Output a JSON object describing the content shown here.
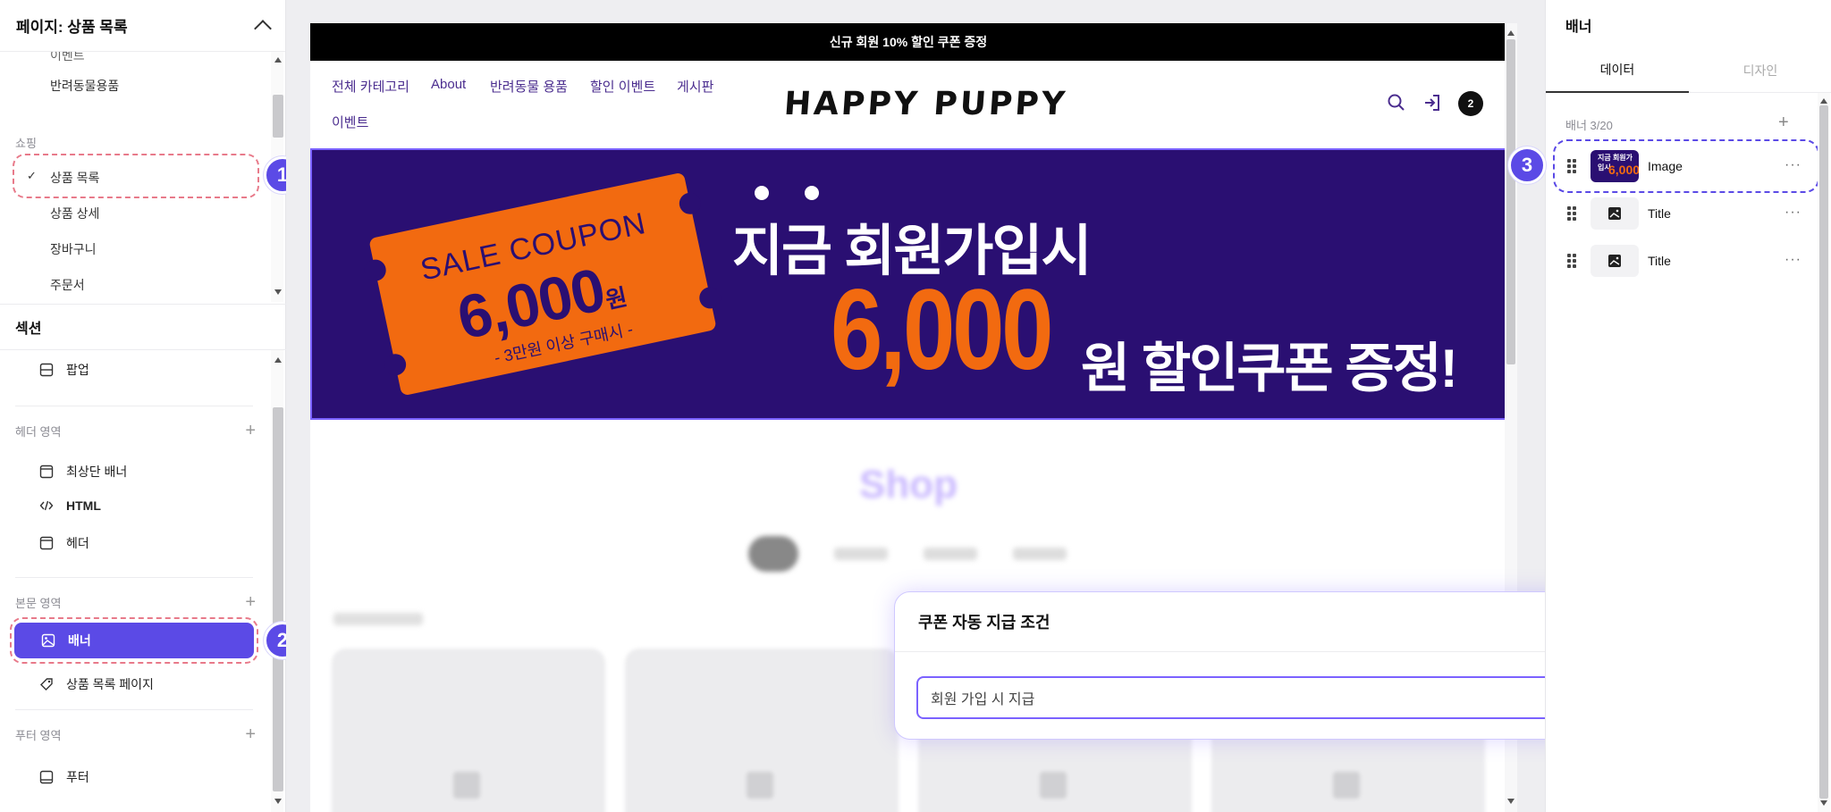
{
  "left": {
    "page_header": "페이지: 상품 목록",
    "pages_group_1_items": [
      "이벤트",
      "반려동물용품"
    ],
    "shopping_label": "쇼핑",
    "shopping_items": [
      "상품 목록",
      "상품 상세",
      "장바구니",
      "주문서"
    ],
    "section_title": "섹션",
    "popup_item": "팝업",
    "header_area": {
      "label": "헤더 영역",
      "items": [
        "최상단 배너",
        "HTML",
        "헤더"
      ]
    },
    "body_area": {
      "label": "본문 영역",
      "items": [
        "배너",
        "상품 목록 페이지"
      ]
    },
    "footer_area": {
      "label": "푸터 영역",
      "items": [
        "푸터"
      ]
    },
    "badges": [
      "1",
      "2"
    ]
  },
  "canvas": {
    "top_banner": "신규 회원 10% 할인 쿠폰 증정",
    "nav": [
      "전체 카테고리",
      "About",
      "반려동물 용품",
      "할인 이벤트",
      "게시판",
      "이벤트"
    ],
    "logo": "HAPPY PUPPY",
    "cart_count": "2",
    "banner": {
      "coupon_title": "SALE COUPON",
      "coupon_amount": "6,000",
      "coupon_unit": "원",
      "coupon_condition": "- 3만원 이상 구매시 -",
      "headline": "지금 회원가입시",
      "amount": "6,000",
      "rest": "원 할인쿠폰 증정!"
    },
    "shop_title": "Shop",
    "popup": {
      "title": "쿠폰 자동 지급 조건",
      "toggle_on": true,
      "select_value": "회원 가입 시 지급"
    }
  },
  "right": {
    "title": "배너",
    "tabs": [
      "데이터",
      "디자인"
    ],
    "count": "배너 3/20",
    "items": [
      {
        "name": "Image",
        "thumb_text": "지금 회원가입시",
        "thumb_amount": "6,000"
      },
      {
        "name": "Title"
      },
      {
        "name": "Title"
      }
    ],
    "badge": "3"
  },
  "colors": {
    "accent": "#5b4ae6",
    "banner_bg": "#2a0f72",
    "banner_orange": "#f26a10",
    "dashed_highlight": "#e87a8a",
    "nav_text": "#4b2d8f"
  }
}
